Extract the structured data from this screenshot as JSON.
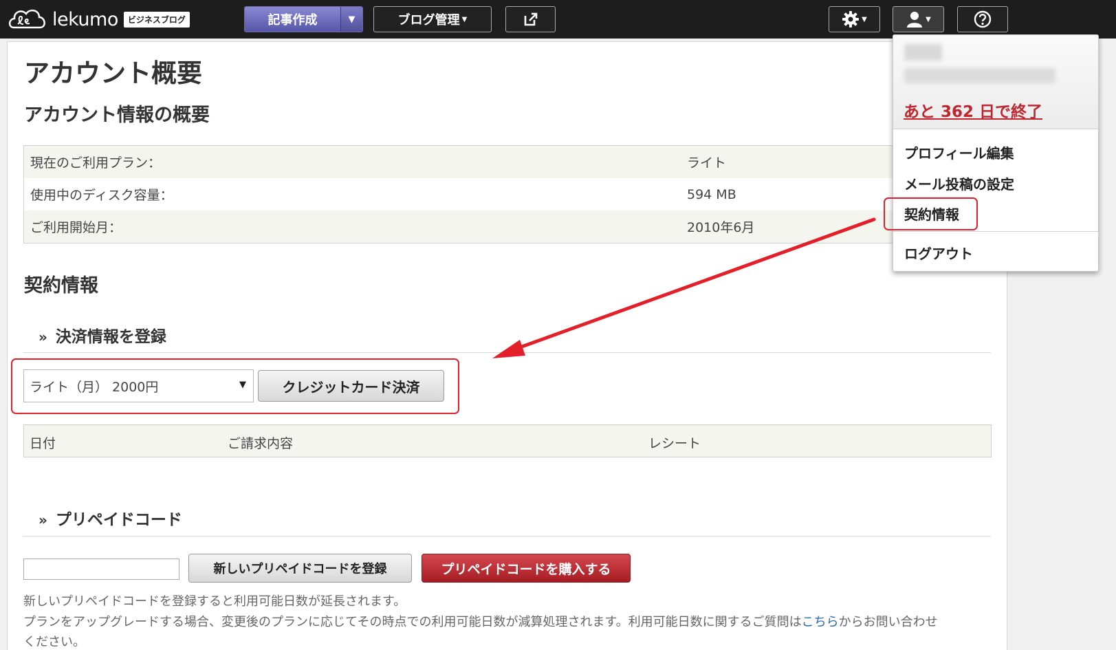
{
  "header": {
    "logo_text": "lekumo",
    "logo_badge": "ビジネスブログ",
    "new_post_label": "記事作成",
    "blog_manage_label": "ブログ管理"
  },
  "page": {
    "title": "アカウント概要",
    "overview_heading": "アカウント情報の概要",
    "overview_rows": [
      {
        "label": "現在のご利用プラン：",
        "value": "ライト"
      },
      {
        "label": "使用中のディスク容量：",
        "value": "594 MB"
      },
      {
        "label": "ご利用開始月：",
        "value": "2010年6月"
      }
    ],
    "contract_heading": "契約情報",
    "payment_subheading": "決済情報を登録",
    "plan_select_value": "ライト（月） 2000円",
    "credit_button_label": "クレジットカード決済",
    "history_columns": [
      "日付",
      "ご請求内容",
      "レシート"
    ],
    "prepaid_subheading": "プリペイドコード",
    "prepaid_register_label": "新しいプリペイドコードを登録",
    "prepaid_buy_label": "プリペイドコードを購入する",
    "note_1": "新しいプリペイドコードを登録すると利用可能日数が延長されます。",
    "note_2_pre": "プランをアップグレードする場合、変更後のプランに応じてその時点での利用可能日数が減算処理されます。利用可能日数に関するご質問は",
    "note_2_link": "こちら",
    "note_2_post": "からお問い合わせ",
    "note_3": "ください。"
  },
  "menu": {
    "expire_text": "あと 362 日で終了",
    "items": [
      "プロフィール編集",
      "メール投稿の設定",
      "契約情報",
      "ログアウト"
    ]
  },
  "colors": {
    "accent_red": "#e3202a",
    "new_post_purple": "#6b6bbf",
    "buy_button_red": "#b52a31"
  }
}
